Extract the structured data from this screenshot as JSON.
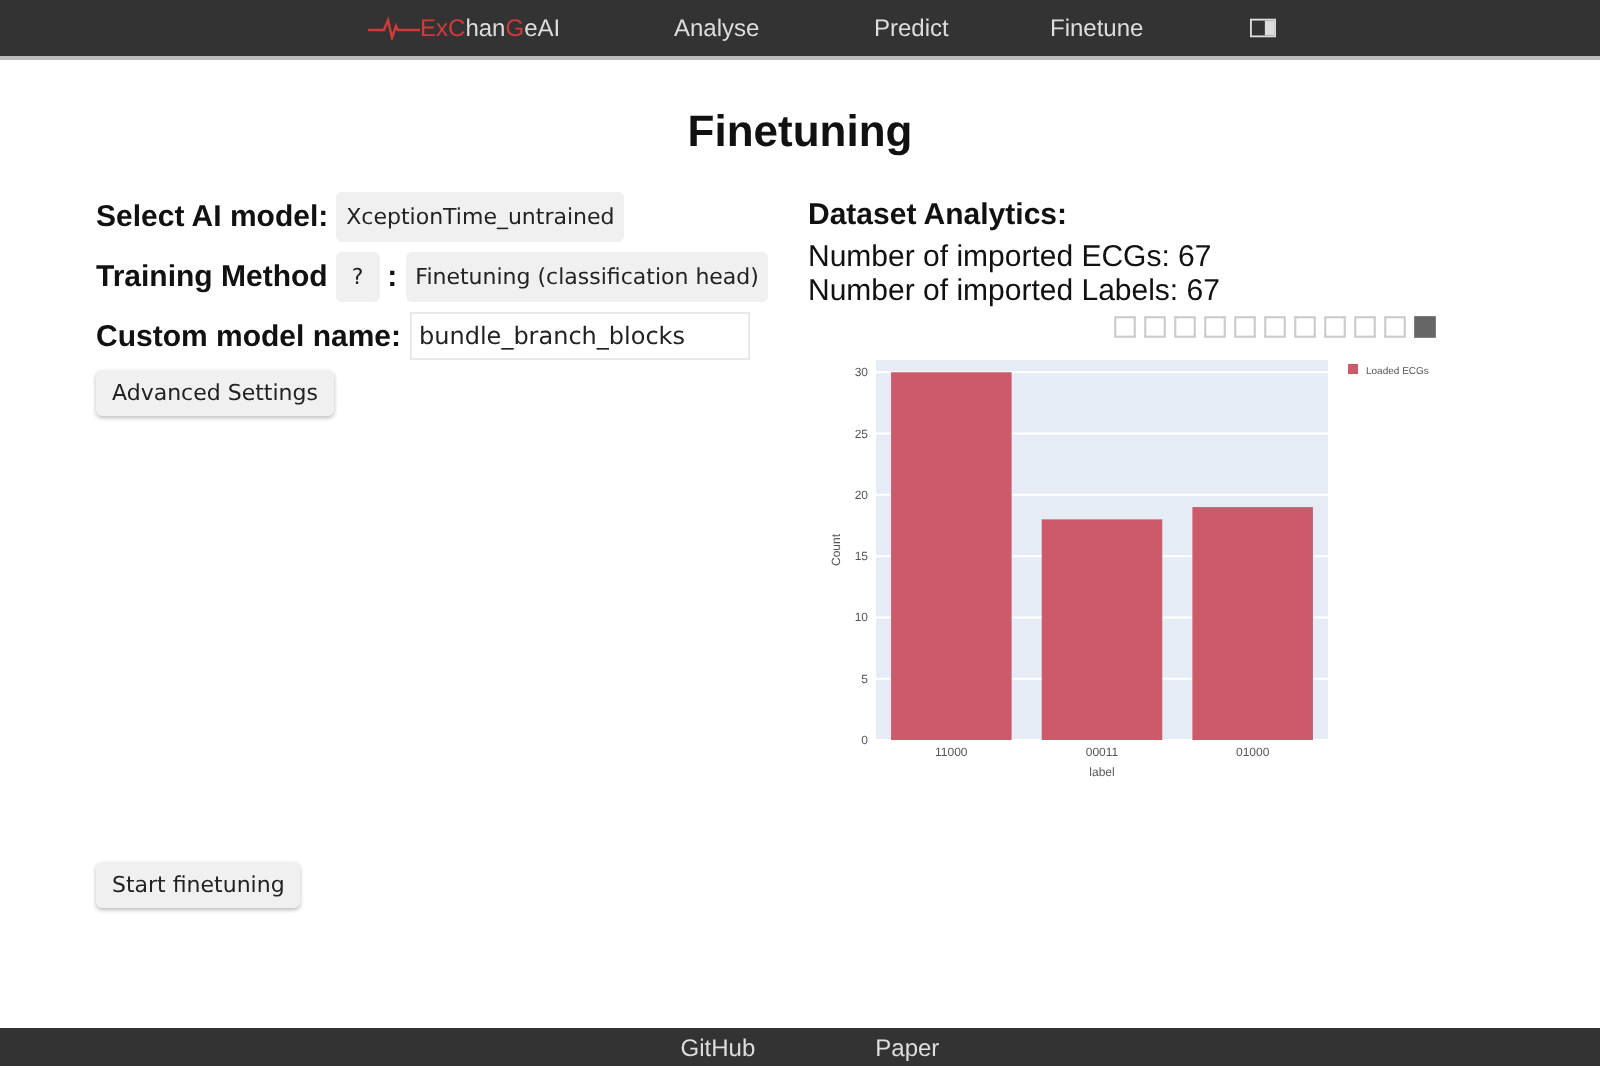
{
  "nav": {
    "logo_parts": [
      {
        "text": "Ex",
        "accent": true
      },
      {
        "text": "C",
        "accent": true
      },
      {
        "text": "han",
        "accent": false
      },
      {
        "text": "G",
        "accent": true
      },
      {
        "text": "eAI",
        "accent": false
      }
    ],
    "items": [
      "Analyse",
      "Predict",
      "Finetune"
    ]
  },
  "title": "Finetuning",
  "form": {
    "model_label": "Select AI model:",
    "model_value": "XceptionTime_untrained",
    "method_label": "Training Method",
    "help_button": "?",
    "colon": ":",
    "method_value": "Finetuning (classification head)",
    "name_label": "Custom model name:",
    "name_value": "bundle_branch_blocks",
    "advanced_button": "Advanced Settings",
    "start_button": "Start finetuning"
  },
  "analytics": {
    "heading": "Dataset Analytics:",
    "lines": [
      "Number of imported ECGs: 67",
      "Number of imported Labels: 67"
    ],
    "chart_data": {
      "type": "bar",
      "xlabel": "label",
      "ylabel": "Count",
      "categories": [
        "11000",
        "00011",
        "01000"
      ],
      "series": [
        {
          "name": "Loaded ECGs",
          "color": "#cc5a6a",
          "values": [
            30,
            18,
            19
          ]
        }
      ],
      "ylim": [
        0,
        31
      ],
      "grid": true,
      "yticks": [
        0,
        5,
        10,
        15,
        20,
        25,
        30
      ]
    }
  },
  "footer": [
    "GitHub",
    "Paper"
  ]
}
